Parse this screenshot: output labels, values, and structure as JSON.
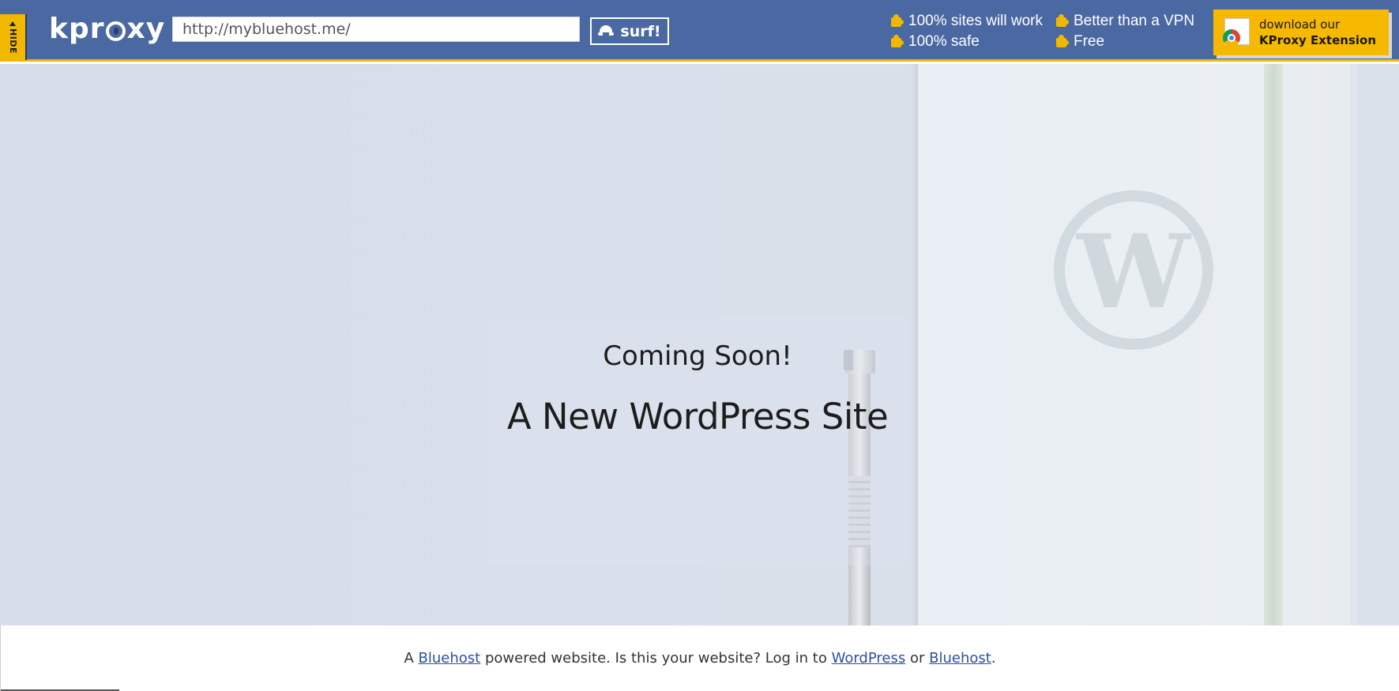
{
  "topbar": {
    "hide_label": "HIDE",
    "logo_text": {
      "part1": "kpr",
      "part2": "xy"
    },
    "url_value": "http://mybluehost.me/",
    "surf_label": "surf!",
    "features": [
      {
        "label": "100% sites will work"
      },
      {
        "label": "100% safe"
      },
      {
        "label": "Better than a VPN"
      },
      {
        "label": "Free"
      }
    ],
    "extension": {
      "line1": "download our",
      "line2": "KProxy Extension"
    },
    "colors": {
      "bar": "#4a68a2",
      "accent": "#f2b800"
    }
  },
  "hero": {
    "heading": "Coming Soon!",
    "title": "A New WordPress Site",
    "wp_logo_letter": "W"
  },
  "footer": {
    "text_a": "A",
    "link_bluehost_1": "Bluehost",
    "text_b": "powered website. Is this your website? Log in to",
    "link_wordpress": "WordPress",
    "text_or": "or",
    "link_bluehost_2": "Bluehost",
    "text_end": "."
  }
}
